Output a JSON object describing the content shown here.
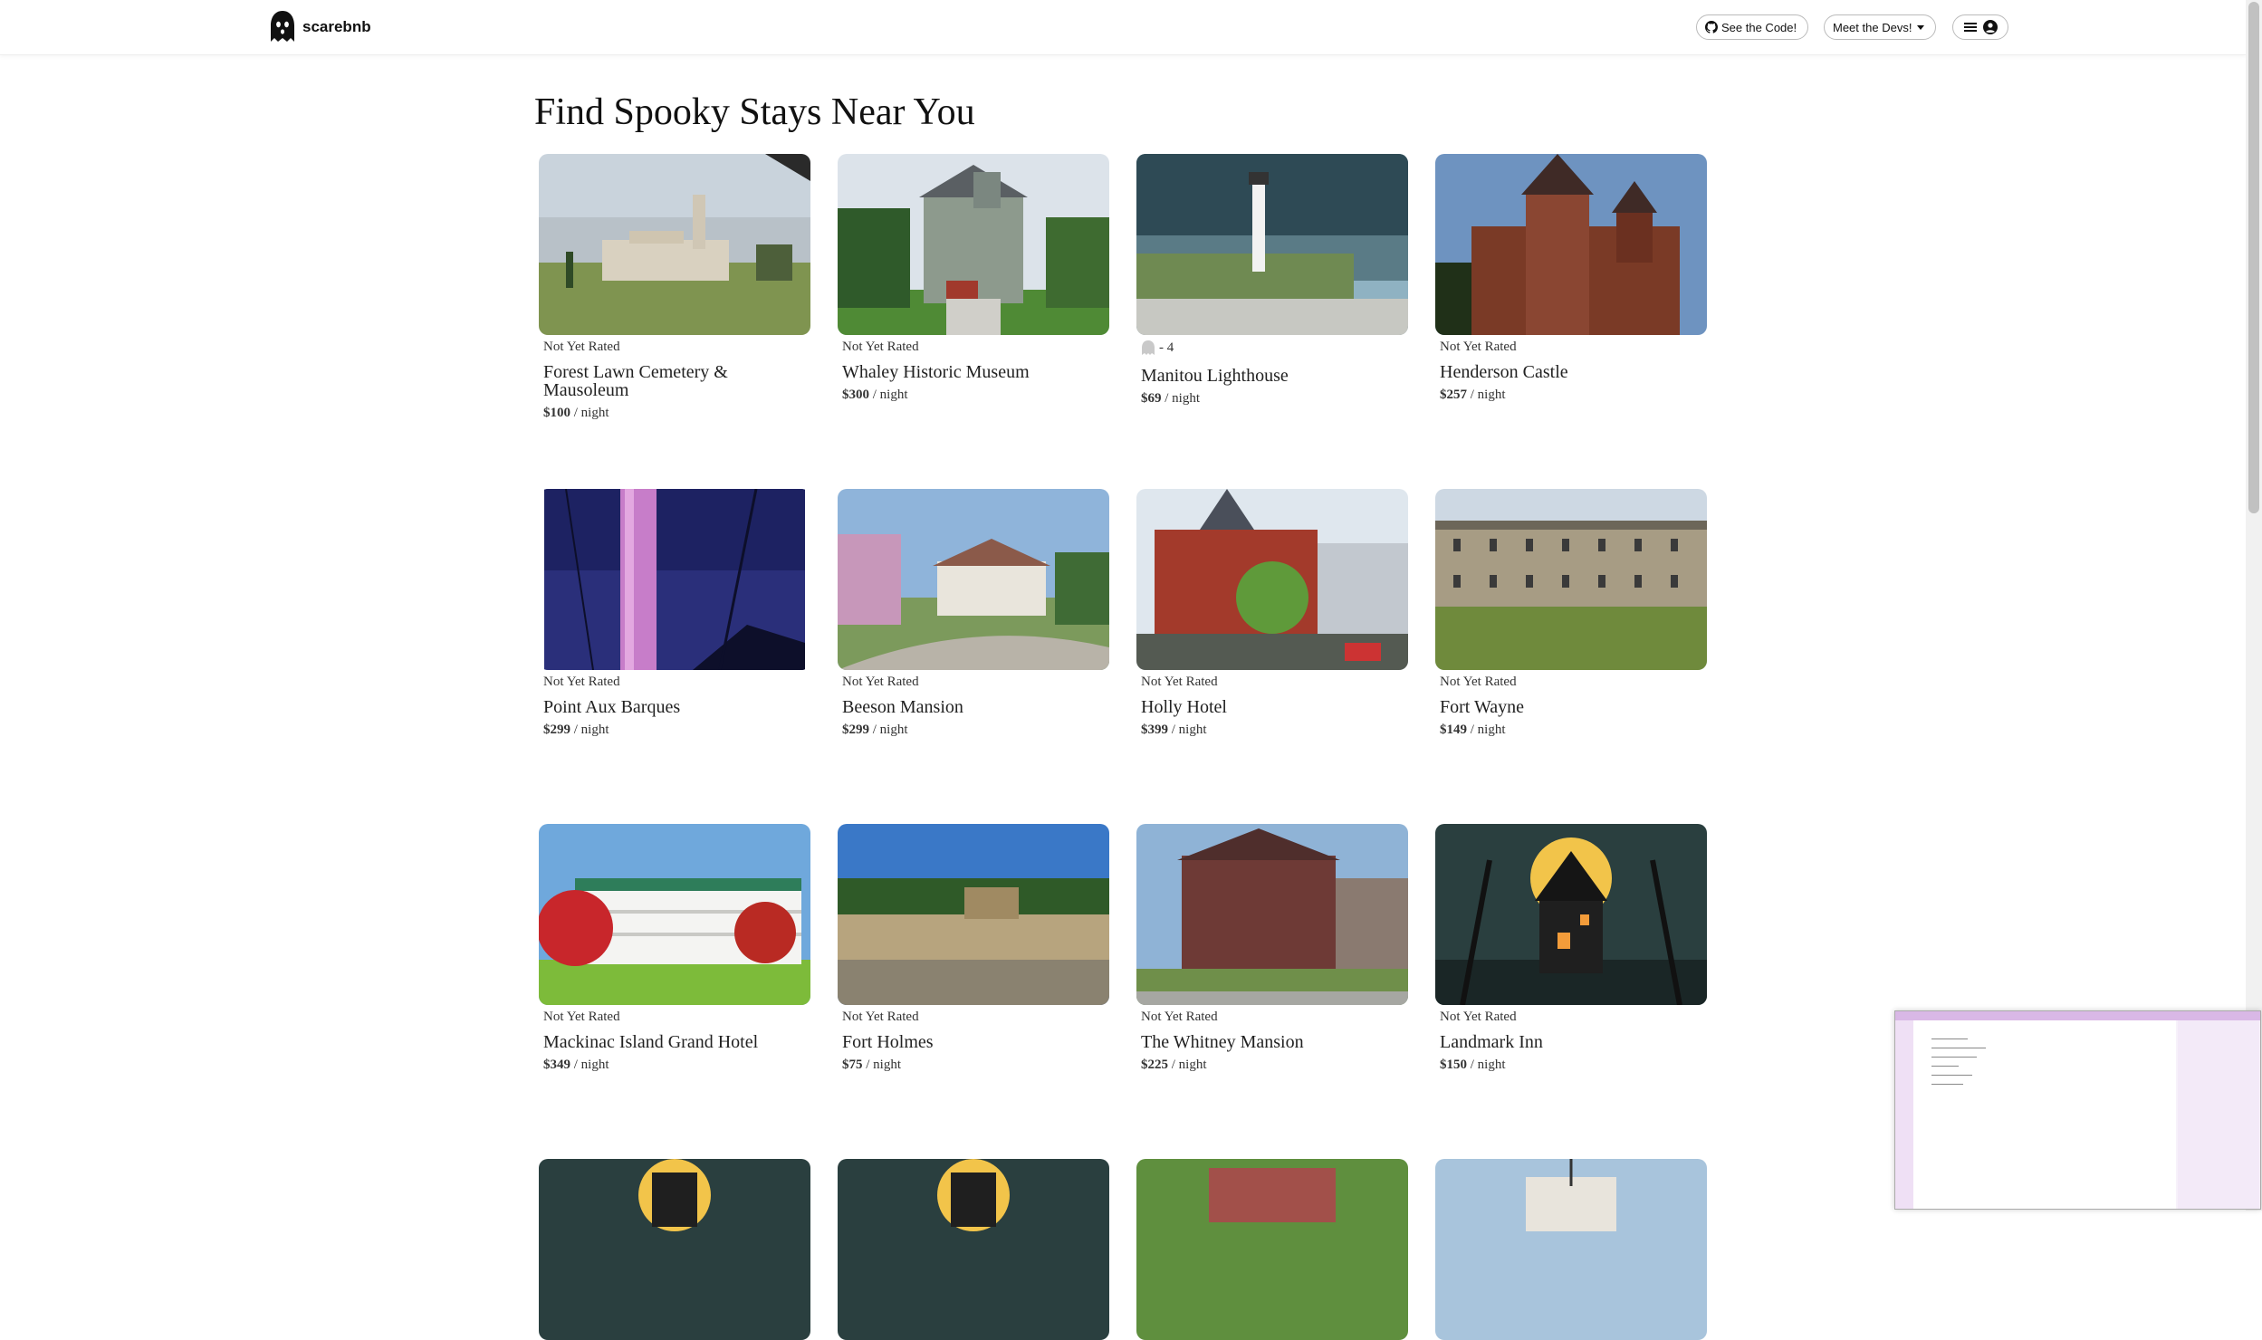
{
  "header": {
    "logo_text": "scarebnb",
    "see_code_label": "See the Code!",
    "meet_devs_label": "Meet the Devs!"
  },
  "page_title": "Find Spooky Stays Near You",
  "listings": [
    {
      "rating": "Not Yet Rated",
      "name": "Forest Lawn Cemetery & Mausoleum",
      "price": "$100",
      "per": "/ night"
    },
    {
      "rating": "Not Yet Rated",
      "name": "Whaley Historic Museum",
      "price": "$300",
      "per": "/ night"
    },
    {
      "rating": "- 4",
      "name": "Manitou Lighthouse",
      "price": "$69",
      "per": "/ night"
    },
    {
      "rating": "Not Yet Rated",
      "name": "Henderson Castle",
      "price": "$257",
      "per": "/ night"
    },
    {
      "rating": "Not Yet Rated",
      "name": "Point Aux Barques",
      "price": "$299",
      "per": "/ night"
    },
    {
      "rating": "Not Yet Rated",
      "name": "Beeson Mansion",
      "price": "$299",
      "per": "/ night"
    },
    {
      "rating": "Not Yet Rated",
      "name": "Holly Hotel",
      "price": "$399",
      "per": "/ night"
    },
    {
      "rating": "Not Yet Rated",
      "name": "Fort Wayne",
      "price": "$149",
      "per": "/ night"
    },
    {
      "rating": "Not Yet Rated",
      "name": "Mackinac Island Grand Hotel",
      "price": "$349",
      "per": "/ night"
    },
    {
      "rating": "Not Yet Rated",
      "name": "Fort Holmes",
      "price": "$75",
      "per": "/ night"
    },
    {
      "rating": "Not Yet Rated",
      "name": "The Whitney Mansion",
      "price": "$225",
      "per": "/ night"
    },
    {
      "rating": "Not Yet Rated",
      "name": "Landmark Inn",
      "price": "$150",
      "per": "/ night"
    }
  ],
  "icons": {
    "logo": "ghost-icon",
    "github": "github-icon",
    "menu": "hamburger-icon",
    "user": "user-circle-icon",
    "rating": "ghost-icon"
  },
  "colors": {
    "accent": "#111111",
    "preview_bar": "#d9b8e6"
  }
}
